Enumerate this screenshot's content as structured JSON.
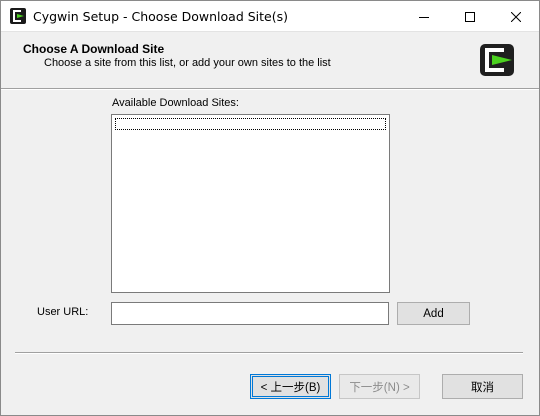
{
  "window": {
    "title": "Cygwin Setup - Choose Download Site(s)",
    "app_icon": "cygwin-icon"
  },
  "header": {
    "title": "Choose A Download Site",
    "subtitle": "Choose a site from this list, or add your own sites to the list",
    "logo": "cygwin-logo"
  },
  "sites": {
    "label": "Available Download Sites:",
    "items": []
  },
  "user_url": {
    "label": "User URL:",
    "value": "",
    "placeholder": ""
  },
  "buttons": {
    "add": "Add",
    "back": "< 上一步(B)",
    "next": "下一步(N) >",
    "cancel": "取消"
  },
  "colors": {
    "accent": "#0078d7",
    "logo_green": "#4bd11f",
    "window_bg": "#f0f0f0"
  }
}
